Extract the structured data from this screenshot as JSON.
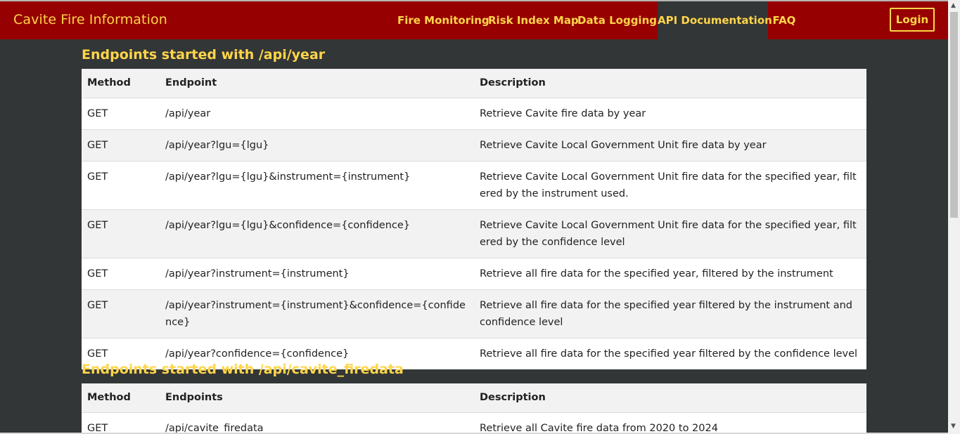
{
  "brand": "Cavite Fire Information",
  "nav": {
    "items": [
      {
        "label": "Fire Monitoring",
        "active": false
      },
      {
        "label": "Risk Index Map",
        "active": false
      },
      {
        "label": "Data Logging",
        "active": false
      },
      {
        "label": "API Documentation",
        "active": true
      },
      {
        "label": "FAQ",
        "active": false
      }
    ],
    "login_label": "Login"
  },
  "sections": [
    {
      "title": "Endpoints started with /api/year",
      "headers": [
        "Method",
        "Endpoint",
        "Description"
      ],
      "rows": [
        {
          "method": "GET",
          "endpoint": "/api/year",
          "description": "Retrieve Cavite fire data by year"
        },
        {
          "method": "GET",
          "endpoint": "/api/year?lgu={lgu}",
          "description": "Retrieve Cavite Local Government Unit fire data by year"
        },
        {
          "method": "GET",
          "endpoint": "/api/year?lgu={lgu}&instrument={instrument}",
          "description": "Retrieve Cavite Local Government Unit fire data for the specified year, filtered by the instrument used."
        },
        {
          "method": "GET",
          "endpoint": "/api/year?lgu={lgu}&confidence={confidence}",
          "description": "Retrieve Cavite Local Government Unit fire data for the specified year, filtered by the confidence level"
        },
        {
          "method": "GET",
          "endpoint": "/api/year?instrument={instrument}",
          "description": "Retrieve all fire data for the specified year, filtered by the instrument"
        },
        {
          "method": "GET",
          "endpoint": "/api/year?instrument={instrument}&confidence={confidence}",
          "description": "Retrieve all fire data for the specified year filtered by the instrument and confidence level"
        },
        {
          "method": "GET",
          "endpoint": "/api/year?confidence={confidence}",
          "description": "Retrieve all fire data for the specified year filtered by the confidence level"
        }
      ]
    },
    {
      "title": "Endpoints started with /api/cavite_firedata",
      "headers": [
        "Method",
        "Endpoints",
        "Description"
      ],
      "rows": [
        {
          "method": "GET",
          "endpoint": "/api/cavite_firedata",
          "description": "Retrieve all Cavite fire data from 2020 to 2024"
        }
      ]
    }
  ]
}
